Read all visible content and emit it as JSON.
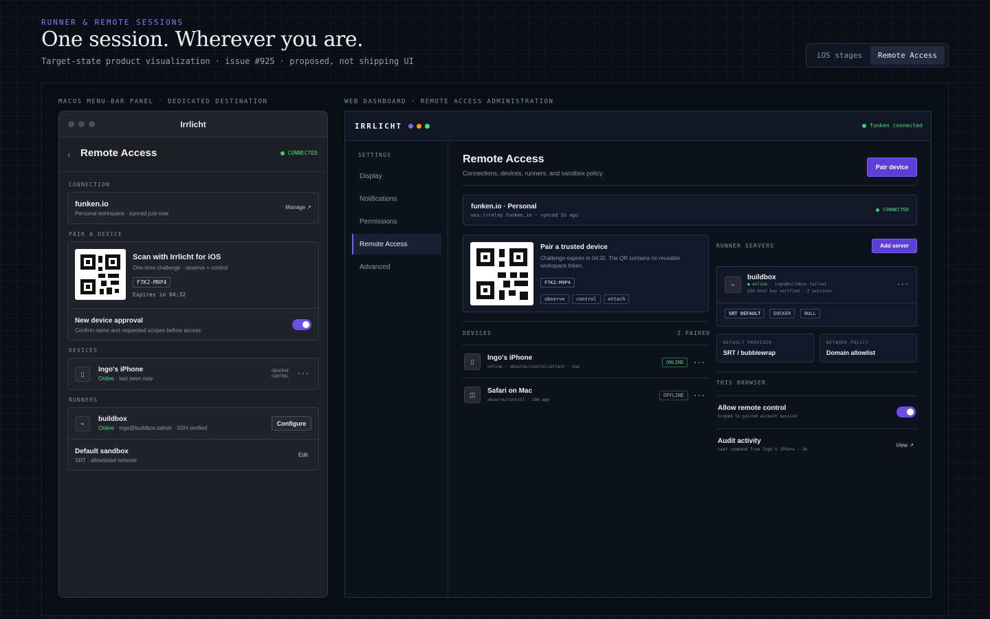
{
  "header": {
    "eyebrow": "RUNNER & REMOTE SESSIONS",
    "title": "One session. Wherever you are.",
    "subtitle": "Target-state product visualization · issue #925 · proposed, not shipping UI"
  },
  "segmented": {
    "options": [
      "iOS stages",
      "Remote Access"
    ],
    "selected": "Remote Access"
  },
  "labels": {
    "mac_section": "MACOS MENU-BAR PANEL · DEDICATED DESTINATION",
    "web_section": "WEB DASHBOARD · REMOTE ACCESS ADMINISTRATION"
  },
  "mac": {
    "window_title": "Irrlicht",
    "heading": "Remote Access",
    "status": "CONNECTED",
    "connection_label": "CONNECTION",
    "connection": {
      "name": "funken.io",
      "detail": "Personal workspace · synced just now",
      "action": "Manage ↗"
    },
    "pair_label": "PAIR A DEVICE",
    "pair": {
      "title": "Scan with Irrlicht for iOS",
      "detail": "One-time challenge · observe + control",
      "code": "F7K2-M9P4",
      "expires": "Expires in 04:32"
    },
    "approval": {
      "title": "New device approval",
      "detail": "Confirm name and requested scopes before access"
    },
    "devices_label": "DEVICES",
    "device": {
      "name": "Ingo's iPhone",
      "status": "Online",
      "seen": " · last seen now",
      "scope1": "OBSERVE",
      "scope2": "CONTROL"
    },
    "runners_label": "RUNNERS",
    "runner": {
      "name": "buildbox",
      "status": "Online",
      "detail": " · ingo@buildbox.tailnet · SSH verified",
      "action": "Configure"
    },
    "sandbox": {
      "title": "Default sandbox",
      "detail": "SRT · allowlisted network",
      "action": "Edit"
    }
  },
  "web": {
    "logo": "IRRLICHT",
    "top_status": "funken connected",
    "settings_label": "SETTINGS",
    "nav": [
      "Display",
      "Notifications",
      "Permissions",
      "Remote Access",
      "Advanced"
    ],
    "nav_active": "Remote Access",
    "title": "Remote Access",
    "subtitle": "Connections, devices, runners, and sandbox policy.",
    "pair_button": "Pair device",
    "connection": {
      "name": "funken.io · Personal",
      "detail": "wss://relay.funken.io · synced 2s ago",
      "status": "CONNECTED"
    },
    "pair": {
      "title": "Pair a trusted device",
      "detail": "Challenge expires in 04:32. The QR contains no reusable workspace token.",
      "code": "F7K2-M9P4",
      "scopes": [
        "observe",
        "control",
        "attach"
      ]
    },
    "devices_label": "DEVICES",
    "devices_count": "2 PAIRED",
    "devices": [
      {
        "name": "Ingo's iPhone",
        "detail": "online · observe/control/attach · now",
        "status": "ONLINE"
      },
      {
        "name": "Safari on Mac",
        "detail": "observe/control · 18m ago",
        "status": "OFFLINE"
      }
    ],
    "runners_label": "RUNNER SERVERS",
    "add_server": "Add server",
    "runner": {
      "name": "buildbox",
      "status": "online",
      "host": " · ingo@buildbox.tailnet",
      "detail": "SSH host key verified · 2 sessions",
      "tags": [
        "SRT DEFAULT",
        "DOCKER",
        "NULL"
      ]
    },
    "provider": {
      "label": "DEFAULT PROVIDER",
      "value": "SRT / bubblewrap"
    },
    "policy": {
      "label": "NETWORK POLICY",
      "value": "Domain allowlist"
    },
    "browser_label": "THIS BROWSER",
    "remote_control": {
      "title": "Allow remote control",
      "detail": "Scoped to paired account session"
    },
    "audit": {
      "title": "Audit activity",
      "detail": "Last command from Ingo's iPhone · 2m",
      "action": "View ↗"
    }
  },
  "colors": {
    "accent": "#6d4ee8",
    "online": "#4ade80",
    "background": "#0b0e16"
  }
}
